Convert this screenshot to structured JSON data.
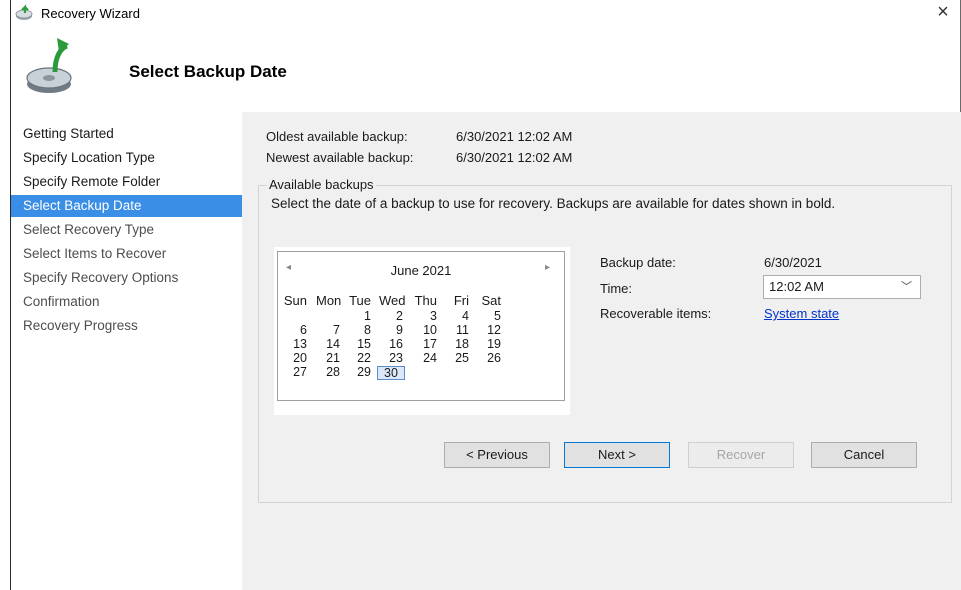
{
  "window": {
    "title": "Recovery Wizard",
    "close_glyph": "×"
  },
  "header": {
    "title": "Select Backup Date"
  },
  "nav": [
    {
      "label": "Getting Started",
      "state": "done"
    },
    {
      "label": "Specify Location Type",
      "state": "done"
    },
    {
      "label": "Specify Remote Folder",
      "state": "done"
    },
    {
      "label": "Select Backup Date",
      "state": "active"
    },
    {
      "label": "Select Recovery Type",
      "state": "pending"
    },
    {
      "label": "Select Items to Recover",
      "state": "pending"
    },
    {
      "label": "Specify Recovery Options",
      "state": "pending"
    },
    {
      "label": "Confirmation",
      "state": "pending"
    },
    {
      "label": "Recovery Progress",
      "state": "pending"
    }
  ],
  "info": {
    "oldest_label": "Oldest available backup:",
    "oldest_value": "6/30/2021 12:02 AM",
    "newest_label": "Newest available backup:",
    "newest_value": "6/30/2021 12:02 AM"
  },
  "backups": {
    "group_label": "Available backups",
    "description": "Select the date of a backup to use for recovery. Backups are available for dates shown in bold."
  },
  "calendar": {
    "prev": "◂",
    "next": "▸",
    "month": "June 2021",
    "weekdays": [
      "Sun",
      "Mon",
      "Tue",
      "Wed",
      "Thu",
      "Fri",
      "Sat"
    ],
    "weeks": [
      [
        "",
        "",
        "1",
        "2",
        "3",
        "4",
        "5"
      ],
      [
        "6",
        "7",
        "8",
        "9",
        "10",
        "11",
        "12"
      ],
      [
        "13",
        "14",
        "15",
        "16",
        "17",
        "18",
        "19"
      ],
      [
        "20",
        "21",
        "22",
        "23",
        "24",
        "25",
        "26"
      ],
      [
        "27",
        "28",
        "29",
        "30",
        "",
        "",
        ""
      ]
    ],
    "selected": "30"
  },
  "details": {
    "backup_date_label": "Backup date:",
    "backup_date_value": "6/30/2021",
    "time_label": "Time:",
    "time_value": "12:02 AM",
    "time_arrow": "﹀",
    "items_label": "Recoverable items:",
    "items_value": "System state"
  },
  "buttons": {
    "previous": "< Previous",
    "next": "Next >",
    "recover": "Recover",
    "cancel": "Cancel"
  },
  "colors": {
    "nav_active": "#3a8ee6",
    "link": "#0033cc",
    "primary_border": "#0078d7"
  },
  "icons": {
    "app": "backup-disk-icon",
    "header": "backup-disk-arrow-icon"
  }
}
